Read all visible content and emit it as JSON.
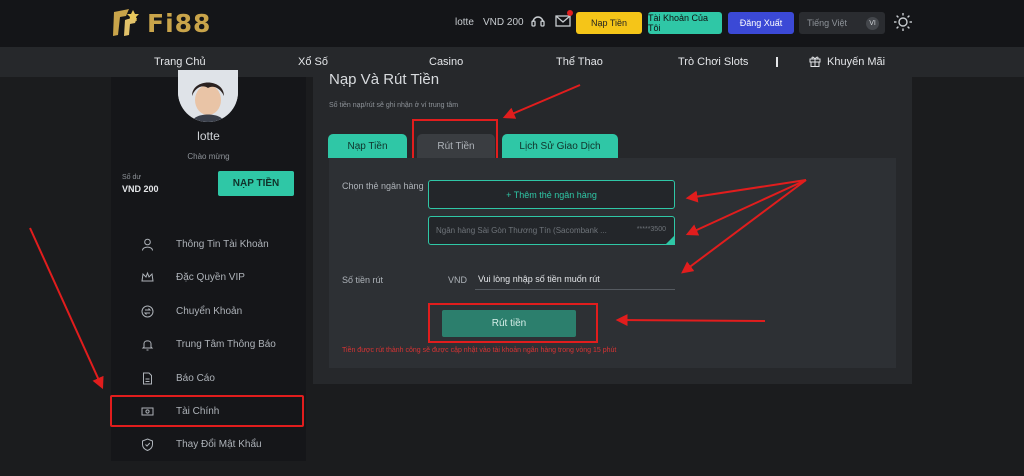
{
  "header": {
    "logo_text": "Fi88",
    "username": "lotte",
    "balance": "VND 200",
    "btn_deposit": "Nạp Tiền",
    "btn_account": "Tài Khoản Của Tôi",
    "btn_logout": "Đăng Xuất",
    "language": "Tiếng Việt",
    "language_code": "VI"
  },
  "nav": {
    "items": [
      "Trang Chủ",
      "Xổ Số",
      "Casino",
      "Thể Thao",
      "Trò Chơi Slots",
      "Khuyến Mãi"
    ]
  },
  "sidebar": {
    "name": "lotte",
    "greeting": "Chào mừng",
    "balance_label": "Số dư",
    "balance": "VND 200",
    "deposit_button": "NẠP TIỀN",
    "items": [
      {
        "label": "Thông Tin Tài Khoản",
        "icon": "user-icon"
      },
      {
        "label": "Đặc Quyền VIP",
        "icon": "crown-icon"
      },
      {
        "label": "Chuyển Khoản",
        "icon": "transfer-icon"
      },
      {
        "label": "Trung Tâm Thông Báo",
        "icon": "bell-icon"
      },
      {
        "label": "Báo Cáo",
        "icon": "report-icon"
      },
      {
        "label": "Tài Chính",
        "icon": "finance-icon"
      },
      {
        "label": "Thay Đổi Mật Khẩu",
        "icon": "shield-icon"
      }
    ]
  },
  "main": {
    "title": "Nạp Và Rút Tiền",
    "subtitle": "Số tiền nạp/rút sẽ ghi nhận ở ví trung tâm",
    "tabs": [
      "Nạp Tiền",
      "Rút Tiền",
      "Lịch Sử Giao Dịch"
    ],
    "bank_label": "Chọn thẻ ngân hàng",
    "add_bank": "+ Thêm thẻ ngân hàng",
    "bank_selected": "Ngân hàng Sài Gòn Thương Tín (Sacombank ...",
    "bank_number": "*****3500",
    "amount_label": "Số tiền rút",
    "currency": "VND",
    "amount_placeholder": "Vui lòng nhập số tiền muốn rút",
    "withdraw_button": "Rút tiền",
    "note": "Tiền được rút thành công sẽ được cập nhật vào tài khoản ngân hàng trong vòng 15 phút"
  },
  "colors": {
    "accent": "#2fc7a6",
    "highlight": "#e11d1d",
    "gold": "#f5c518",
    "logout": "#3b49d6"
  }
}
